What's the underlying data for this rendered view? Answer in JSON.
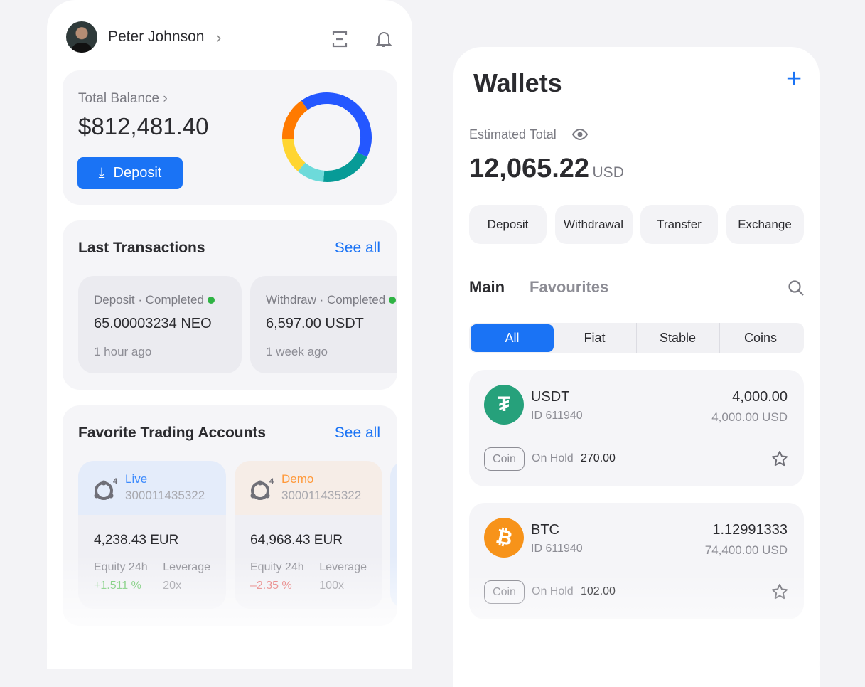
{
  "profile": {
    "name": "Peter Johnson"
  },
  "balance": {
    "label": "Total Balance",
    "amount": "$812,481.40",
    "deposit_label": "Deposit",
    "donut": [
      {
        "color": "#2457ff",
        "share": 42
      },
      {
        "color": "#079b97",
        "share": 19
      },
      {
        "color": "#6ddada",
        "share": 10
      },
      {
        "color": "#ffd531",
        "share": 13
      },
      {
        "color": "#ff7a00",
        "share": 16
      }
    ]
  },
  "transactions": {
    "title": "Last Transactions",
    "see_all": "See all",
    "items": [
      {
        "type": "Deposit · Completed",
        "amount": "65.00003234 NEO",
        "time": "1 hour ago",
        "status_color": "#2fb344"
      },
      {
        "type": "Withdraw · Completed",
        "amount": "6,597.00 USDT",
        "time": "1 week ago",
        "status_color": "#2fb344"
      }
    ]
  },
  "accounts": {
    "title": "Favorite Trading Accounts",
    "see_all": "See all",
    "items": [
      {
        "platform": "4",
        "kind": "Live",
        "kind_color": "#3d8bfd",
        "header_bg": "#e4ecfa",
        "number": "300011435322",
        "balance": "4,238.43 EUR",
        "equity_label": "Equity 24h",
        "equity": "+1.511 %",
        "equity_color": "#5cc05c",
        "leverage_label": "Leverage",
        "leverage": "20x"
      },
      {
        "platform": "4",
        "kind": "Demo",
        "kind_color": "#ff9a3c",
        "header_bg": "#f6ede7",
        "number": "300011435322",
        "balance": "64,968.43 EUR",
        "equity_label": "Equity 24h",
        "equity": "–2.35 %",
        "equity_color": "#e26565",
        "leverage_label": "Leverage",
        "leverage": "100x"
      }
    ]
  },
  "wallets": {
    "title": "Wallets",
    "add": "+",
    "estimated_label": "Estimated Total",
    "total": "12,065.22",
    "currency": "USD",
    "actions": [
      "Deposit",
      "Withdrawal",
      "Transfer",
      "Exchange"
    ],
    "tabs": [
      "Main",
      "Favourites"
    ],
    "filters": [
      "All",
      "Fiat",
      "Stable",
      "Coins"
    ],
    "active_filter": "All",
    "items": [
      {
        "symbol": "USDT",
        "icon": "tether-icon",
        "color": "#26a17b",
        "id": "ID 611940",
        "amount": "4,000.00",
        "usd": "4,000.00 USD",
        "tag": "Coin",
        "hold_label": "On Hold",
        "hold": "270.00"
      },
      {
        "symbol": "BTC",
        "icon": "bitcoin-icon",
        "color": "#f7931a",
        "id": "ID 611940",
        "amount": "1.12991333",
        "usd": "74,400.00 USD",
        "tag": "Coin",
        "hold_label": "On Hold",
        "hold": "102.00"
      }
    ]
  }
}
